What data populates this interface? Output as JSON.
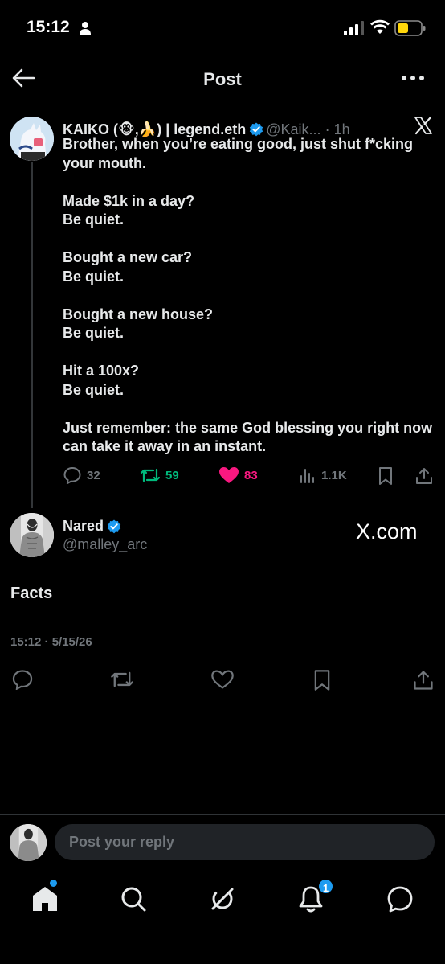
{
  "status_bar": {
    "time": "15:12"
  },
  "header": {
    "title": "Post"
  },
  "quoted_tweet": {
    "author_name": "KAIKO (🐵,🍌) | legend.eth",
    "handle": "@Kaik...",
    "time": "· 1h",
    "lines": [
      "Brother, when you’re eating good, just shut f*cking your mouth.",
      "Made $1k in a day?\nBe quiet.",
      "Bought a new car?\nBe quiet.",
      "Bought a new house?\nBe quiet.",
      "Hit a 100x?\nBe quiet.",
      "Just remember: the same God blessing you right now can take it away in an instant."
    ],
    "stats": {
      "replies": "32",
      "reposts": "59",
      "likes": "83",
      "views": "1.1K"
    }
  },
  "post": {
    "author_name": "Nared",
    "handle": "@malley_arc",
    "watermark": "X.com",
    "text": "Facts",
    "timestamp": "15:12 · 5/15/26"
  },
  "reply": {
    "placeholder": "Post your reply"
  },
  "bottom_nav": {
    "notification_count": "1"
  },
  "colors": {
    "background": "#000000",
    "text": "#e7e9ea",
    "muted": "#71767b",
    "accent": "#1d9bf0",
    "repost": "#00ba7c",
    "like": "#f91880"
  }
}
